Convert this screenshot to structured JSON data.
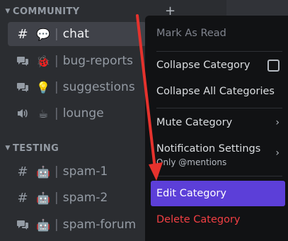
{
  "sidebar": {
    "categories": [
      {
        "label": "COMMUNITY"
      },
      {
        "label": "TESTING"
      }
    ],
    "add_symbol": "+",
    "channels": [
      {
        "emoji": "💬",
        "name": "chat",
        "type": "text"
      },
      {
        "emoji": "🐞",
        "name": "bug-reports",
        "type": "forum"
      },
      {
        "emoji": "💡",
        "name": "suggestions",
        "type": "forum"
      },
      {
        "emoji": "☕",
        "name": "lounge",
        "type": "voice"
      },
      {
        "emoji": "🤖",
        "name": "spam-1",
        "type": "text"
      },
      {
        "emoji": "🤖",
        "name": "spam-2",
        "type": "text"
      },
      {
        "emoji": "🤖",
        "name": "spam-forum",
        "type": "forum"
      }
    ],
    "separator": "|",
    "hash": "#"
  },
  "context_menu": {
    "mark_as_read": "Mark As Read",
    "collapse_category": "Collapse Category",
    "collapse_all": "Collapse All Categories",
    "mute_category": "Mute Category",
    "notification_settings": "Notification Settings",
    "notification_sub": "Only @mentions",
    "edit_category": "Edit Category",
    "delete_category": "Delete Category",
    "chevron": "›"
  },
  "colors": {
    "highlight": "#5c3fd8",
    "danger": "#f23f43",
    "arrow": "#e5322d"
  }
}
